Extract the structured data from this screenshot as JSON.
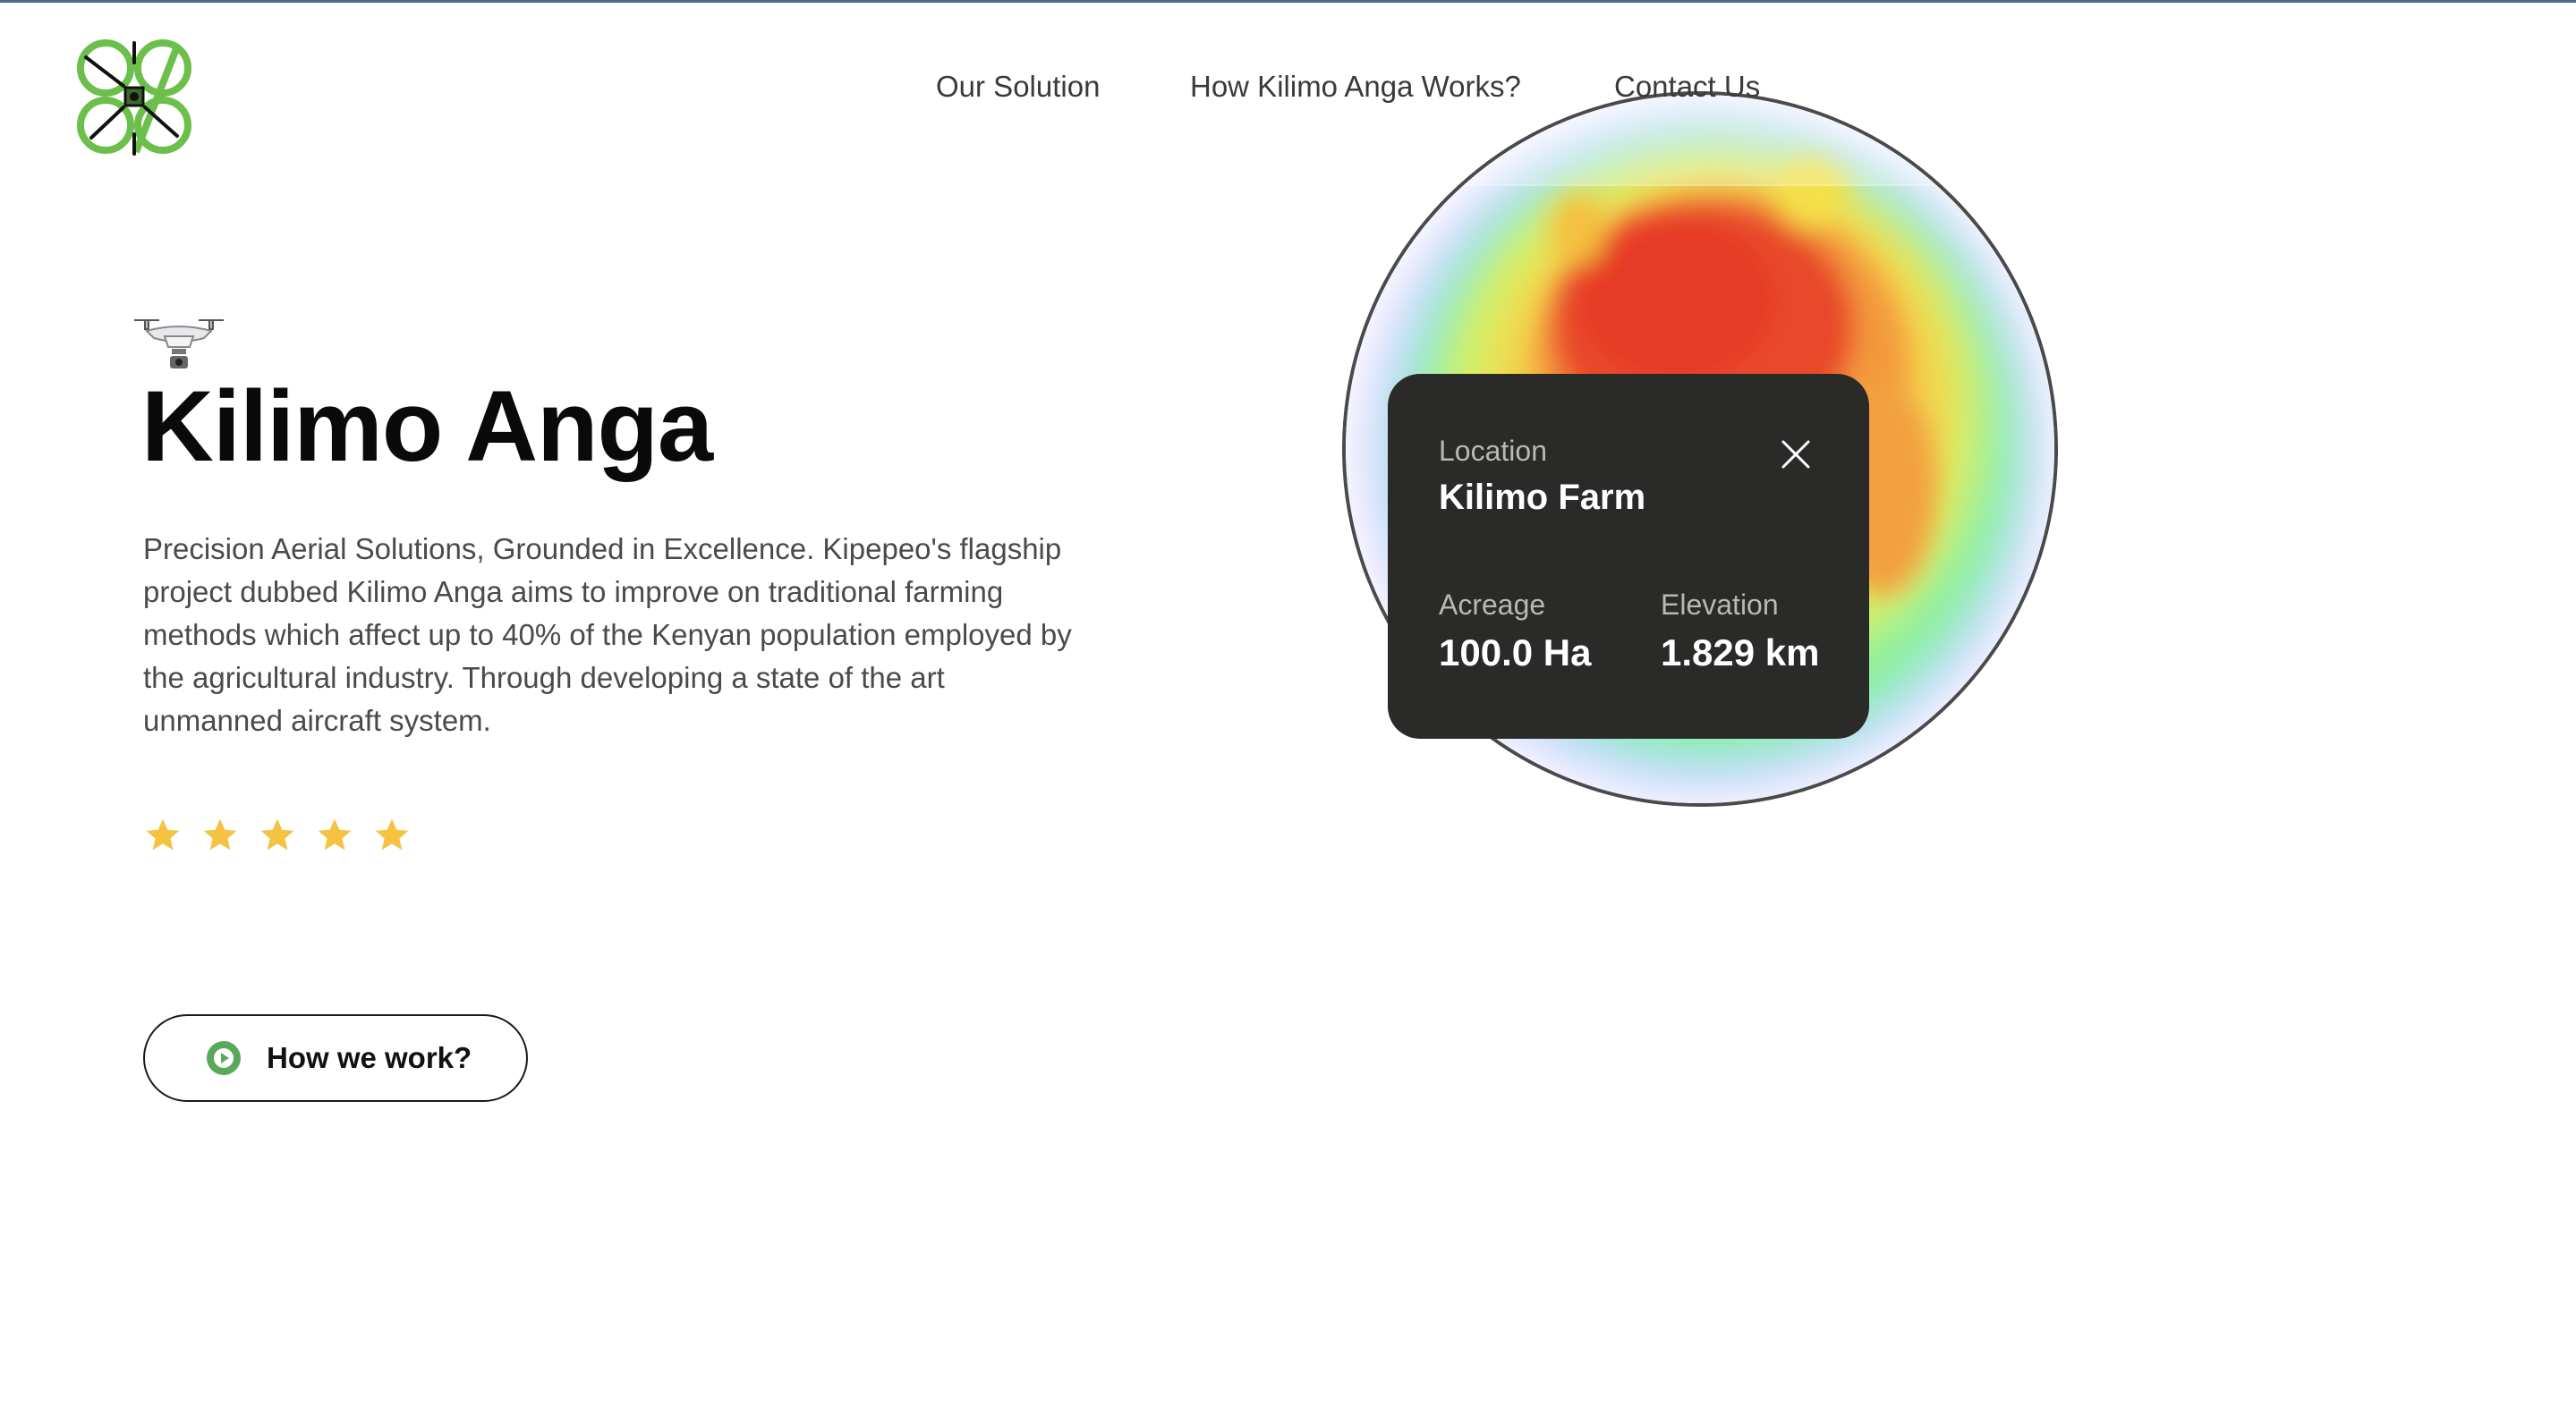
{
  "nav": {
    "items": [
      {
        "label": "Our Solution"
      },
      {
        "label": "How Kilimo Anga Works?"
      },
      {
        "label": "Contact Us"
      }
    ]
  },
  "logo": {
    "icon": "drone-butterfly-logo-icon",
    "color": "#6cbf4a"
  },
  "hero": {
    "title": "Kilimo Anga",
    "description": "Precision Aerial Solutions, Grounded in Excellence. Kipepeo's flagship project dubbed Kilimo Anga aims to improve on traditional farming methods which affect up to 40% of the Kenyan population employed by the agricultural industry. Through developing a state of the art unmanned aircraft system.",
    "rating": {
      "value": 5,
      "max": 5,
      "star_color": "#f5c242"
    },
    "cta_label": "How we work?",
    "cta_icon_color": "#5aa85a"
  },
  "info_card": {
    "location_label": "Location",
    "location_value": "Kilimo Farm",
    "acreage_label": "Acreage",
    "acreage_value": "100.0 Ha",
    "elevation_label": "Elevation",
    "elevation_value": "1.829 km",
    "background": "#2a2b28"
  },
  "heatmap": {
    "colors": [
      "#e8e8ff",
      "#9fdcff",
      "#8ff09a",
      "#f2f25a",
      "#f5a640",
      "#e83a2a"
    ]
  }
}
